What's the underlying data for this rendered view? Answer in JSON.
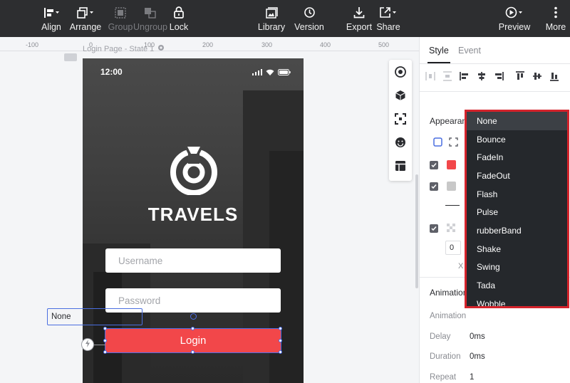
{
  "toolbar": {
    "align": "Align",
    "arrange": "Arrange",
    "group": "Group",
    "ungroup": "Ungroup",
    "lock": "Lock",
    "library": "Library",
    "version": "Version",
    "export": "Export",
    "share": "Share",
    "preview": "Preview",
    "more": "More"
  },
  "ruler": {
    "ticks": [
      "-100",
      "0",
      "100",
      "200",
      "300",
      "400",
      "500"
    ]
  },
  "canvas": {
    "page_label": "Login Page - State 1"
  },
  "phone": {
    "time": "12:00",
    "brand": "TRAVELS",
    "username_placeholder": "Username",
    "password_placeholder": "Password",
    "login_label": "Login"
  },
  "panel": {
    "tab_style": "Style",
    "tab_event": "Event",
    "appearance_title": "Appearan",
    "fill_color": "#f2474a",
    "border_color": "#c8c8c8",
    "opacity_value": "0",
    "x_label": "X",
    "animation_title": "Animation",
    "animation_label": "Animation",
    "animation_value": "None",
    "delay_label": "Delay",
    "delay_value": "0ms",
    "duration_label": "Duration",
    "duration_value": "0ms",
    "repeat_label": "Repeat",
    "repeat_value": "1"
  },
  "dropdown": {
    "options": [
      "None",
      "Bounce",
      "FadeIn",
      "FadeOut",
      "Flash",
      "Pulse",
      "rubberBand",
      "Shake",
      "Swing",
      "Tada",
      "Wobble"
    ],
    "selected": "None",
    "highlight_color": "#d4232b"
  },
  "colors": {
    "toolbar_bg": "#2d2e30",
    "accent_red": "#f2474a",
    "selection_blue": "#4c6ee8"
  }
}
